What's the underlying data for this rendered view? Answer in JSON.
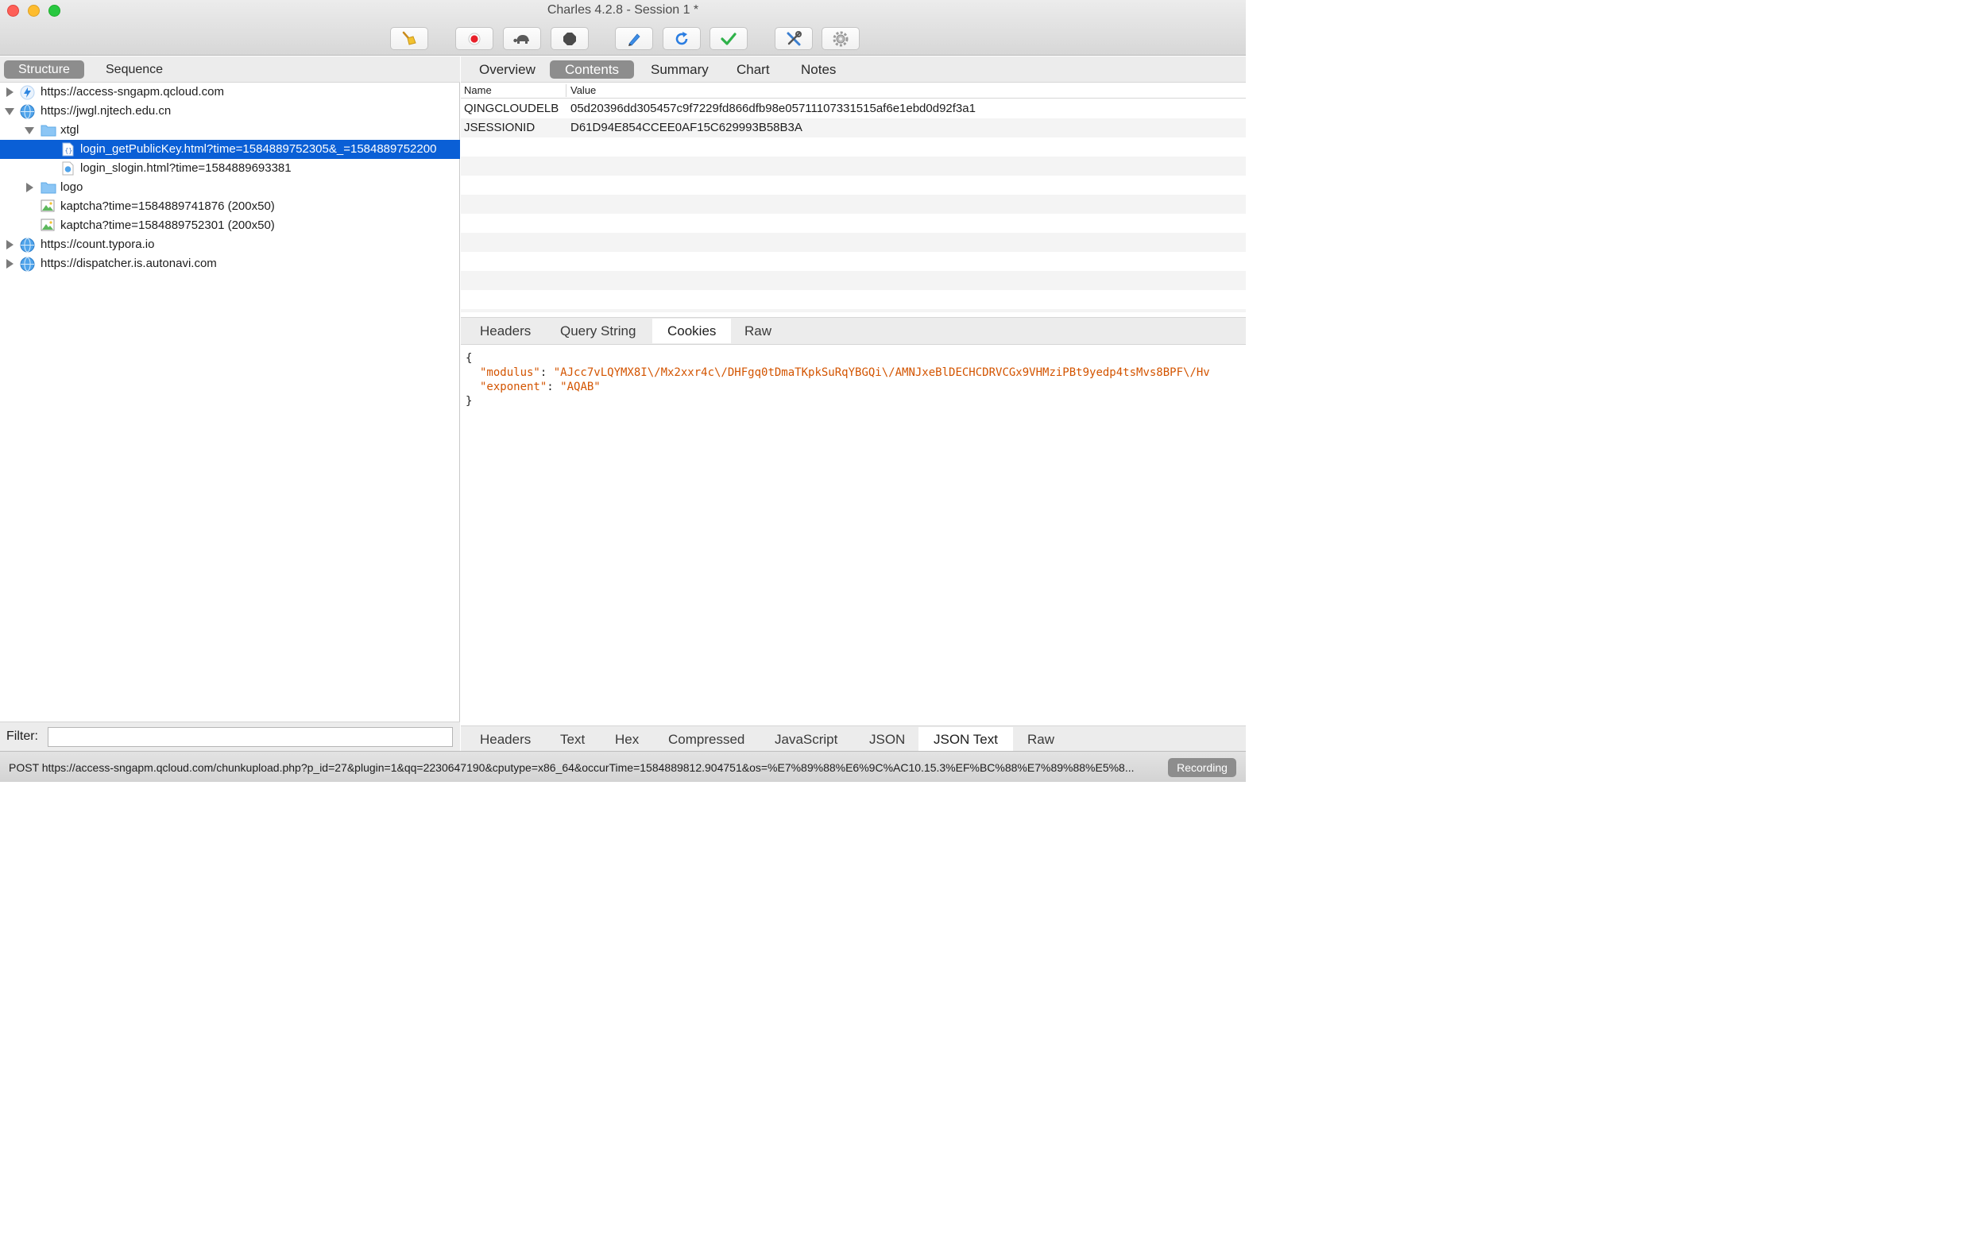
{
  "window": {
    "title": "Charles 4.2.8 - Session 1 *"
  },
  "toolbar": {
    "buttons": [
      {
        "name": "broom-icon"
      },
      {
        "name": "record-icon"
      },
      {
        "name": "turtle-icon"
      },
      {
        "name": "stop-icon"
      },
      {
        "name": "pen-icon"
      },
      {
        "name": "refresh-icon"
      },
      {
        "name": "checkmark-icon"
      },
      {
        "name": "tools-icon"
      },
      {
        "name": "settings-icon"
      }
    ]
  },
  "left": {
    "tabs": {
      "structure": "Structure",
      "sequence": "Sequence"
    },
    "tree": [
      {
        "label": "https://access-sngapm.qcloud.com",
        "icon": "lightning-icon",
        "expanded": false
      },
      {
        "label": "https://jwgl.njtech.edu.cn",
        "icon": "globe-icon",
        "expanded": true
      },
      {
        "label": "xtgl",
        "icon": "folder-icon",
        "expanded": true
      },
      {
        "label": "login_getPublicKey.html?time=1584889752305&_=1584889752200",
        "icon": "json-file-icon",
        "selected": true
      },
      {
        "label": "login_slogin.html?time=1584889693381",
        "icon": "html-file-icon"
      },
      {
        "label": "logo",
        "icon": "folder-icon",
        "expanded": false
      },
      {
        "label": "kaptcha?time=1584889741876 (200x50)",
        "icon": "image-icon"
      },
      {
        "label": "kaptcha?time=1584889752301 (200x50)",
        "icon": "image-icon"
      },
      {
        "label": "https://count.typora.io",
        "icon": "globe-icon",
        "expanded": false
      },
      {
        "label": "https://dispatcher.is.autonavi.com",
        "icon": "globe-icon",
        "expanded": false
      }
    ],
    "filter": {
      "label": "Filter:",
      "value": ""
    }
  },
  "right": {
    "tabs": {
      "overview": "Overview",
      "contents": "Contents",
      "summary": "Summary",
      "chart": "Chart",
      "notes": "Notes"
    },
    "cookie_table": {
      "columns": {
        "name": "Name",
        "value": "Value"
      },
      "rows": [
        {
          "name": "QINGCLOUDELB",
          "value": "05d20396dd305457c9f7229fd866dfb98e05711107331515af6e1ebd0d92f3a1"
        },
        {
          "name": "JSESSIONID",
          "value": "D61D94E854CCEE0AF15C629993B58B3A"
        }
      ]
    },
    "request_tabs": {
      "headers": "Headers",
      "query_string": "Query String",
      "cookies": "Cookies",
      "raw": "Raw"
    },
    "json": {
      "open": "{",
      "modulus_key": "\"modulus\"",
      "modulus_value": "\"AJcc7vLQYMX8I\\/Mx2xxr4c\\/DHFgq0tDmaTKpkSuRqYBGQi\\/AMNJxeBlDECHCDRVCGx9VHMziPBt9yedp4tsMvs8BPF\\/Hv",
      "exponent_key": "\"exponent\"",
      "exponent_value": "\"AQAB\"",
      "colon": ": ",
      "comma": ",",
      "close": "}"
    },
    "response_tabs": {
      "headers": "Headers",
      "text": "Text",
      "hex": "Hex",
      "compressed": "Compressed",
      "javascript": "JavaScript",
      "json": "JSON",
      "json_text": "JSON Text",
      "raw": "Raw"
    }
  },
  "status": {
    "text": "POST https://access-sngapm.qcloud.com/chunkupload.php?p_id=27&plugin=1&qq=2230647190&cputype=x86_64&occurTime=1584889812.904751&os=%E7%89%88%E6%9C%AC10.15.3%EF%BC%88%E7%89%88%E5%8...",
    "recording": "Recording"
  }
}
